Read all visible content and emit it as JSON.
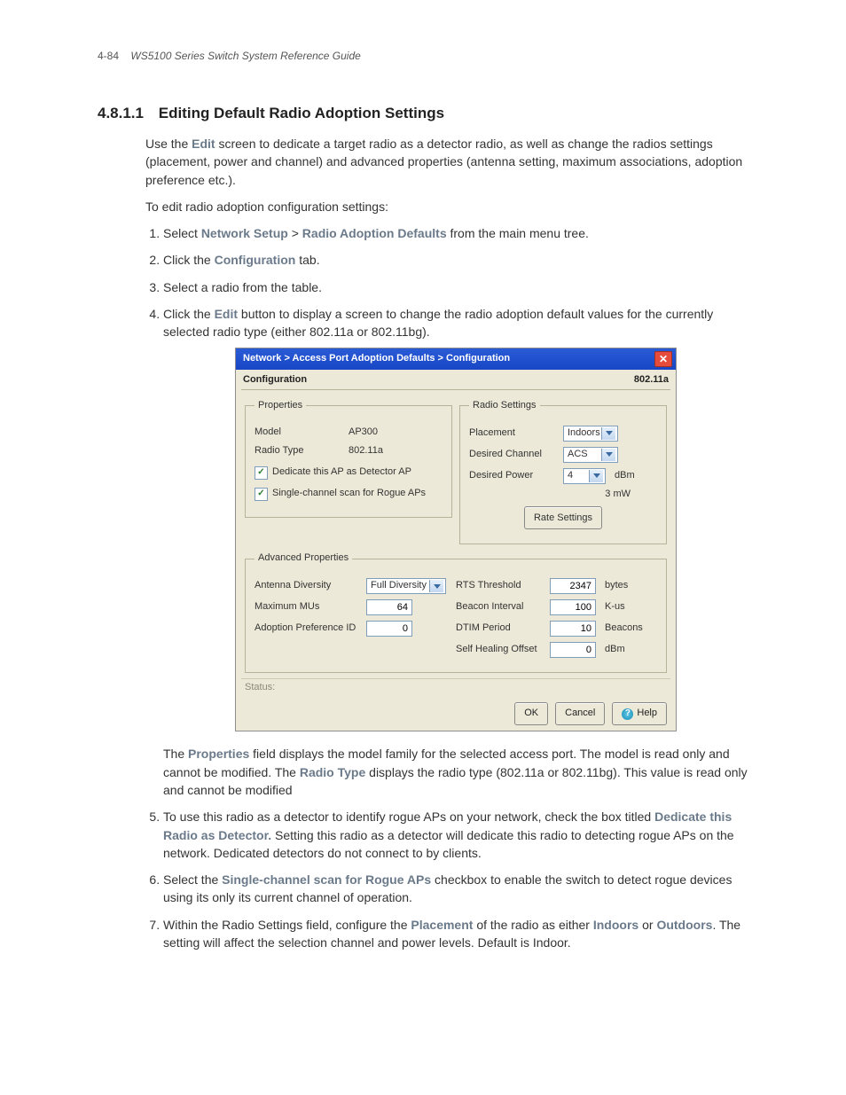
{
  "header": {
    "page_number": "4-84",
    "doc_title": "WS5100 Series Switch System Reference Guide"
  },
  "section": {
    "number": "4.8.1.1",
    "title": "Editing Default Radio Adoption Settings"
  },
  "intro": {
    "p1_a": "Use the ",
    "p1_edit": "Edit",
    "p1_b": " screen to dedicate a target radio as a detector radio, as well as change the radios settings (placement, power and channel) and advanced properties (antenna setting, maximum associations, adoption preference etc.).",
    "p2": "To edit radio adoption configuration settings:"
  },
  "steps": {
    "s1_a": "Select ",
    "s1_b": "Network Setup",
    "s1_c": " > ",
    "s1_d": "Radio Adoption Defaults",
    "s1_e": " from the main menu tree.",
    "s2_a": "Click the ",
    "s2_b": "Configuration",
    "s2_c": " tab.",
    "s3": "Select a radio from the table.",
    "s4_a": "Click the ",
    "s4_b": "Edit",
    "s4_c": " button to display a screen to change the radio adoption default values for the currently selected radio type (either 802.11a or 802.11bg).",
    "post4_a": "The ",
    "post4_b": "Properties",
    "post4_c": " field displays the model family for the selected access port. The model is read only and cannot be modified. The ",
    "post4_d": "Radio Type",
    "post4_e": " displays the radio type (802.11a or 802.11bg). This value is read only and cannot be modified",
    "s5_a": "To use this radio as a detector to identify rogue APs on your network, check the box titled ",
    "s5_b": "Dedicate this Radio as Detector.",
    "s5_c": " Setting this radio as a detector will dedicate this radio to detecting rogue APs on the network. Dedicated detectors do not connect to by clients.",
    "s6_a": "Select the ",
    "s6_b": "Single-channel scan for Rogue APs",
    "s6_c": " checkbox to enable the switch to detect rogue devices using its only its current channel of operation.",
    "s7_a": "Within the Radio Settings field, configure the ",
    "s7_b": "Placement",
    "s7_c": " of the radio as either ",
    "s7_d": "Indoors",
    "s7_e": " or ",
    "s7_f": "Outdoors",
    "s7_g": ". The setting will affect the selection channel and power levels. Default is Indoor."
  },
  "dialog": {
    "titlebar": "Network > Access Port Adoption Defaults > Configuration",
    "tab_label": "Configuration",
    "mode_label": "802.11a",
    "groups": {
      "properties": "Properties",
      "radio_settings": "Radio Settings",
      "advanced": "Advanced Properties"
    },
    "properties": {
      "model_label": "Model",
      "model_value": "AP300",
      "radio_type_label": "Radio Type",
      "radio_type_value": "802.11a",
      "dedicate_label": "Dedicate this AP as Detector AP",
      "single_channel_label": "Single-channel scan for Rogue APs"
    },
    "radio_settings": {
      "placement_label": "Placement",
      "placement_value": "Indoors",
      "channel_label": "Desired Channel",
      "channel_value": "ACS",
      "power_label": "Desired Power",
      "power_value": "4",
      "power_unit": "dBm",
      "power_hint": "3 mW",
      "rate_btn": "Rate Settings"
    },
    "advanced": {
      "antenna_label": "Antenna Diversity",
      "antenna_value": "Full Diversity",
      "max_mus_label": "Maximum MUs",
      "max_mus_value": "64",
      "adopt_pref_label": "Adoption Preference ID",
      "adopt_pref_value": "0",
      "rts_label": "RTS Threshold",
      "rts_value": "2347",
      "rts_unit": "bytes",
      "beacon_label": "Beacon Interval",
      "beacon_value": "100",
      "beacon_unit": "K-us",
      "dtim_label": "DTIM Period",
      "dtim_value": "10",
      "dtim_unit": "Beacons",
      "self_heal_label": "Self Healing Offset",
      "self_heal_value": "0",
      "self_heal_unit": "dBm"
    },
    "status_label": "Status:",
    "buttons": {
      "ok": "OK",
      "cancel": "Cancel",
      "help": "Help"
    }
  }
}
